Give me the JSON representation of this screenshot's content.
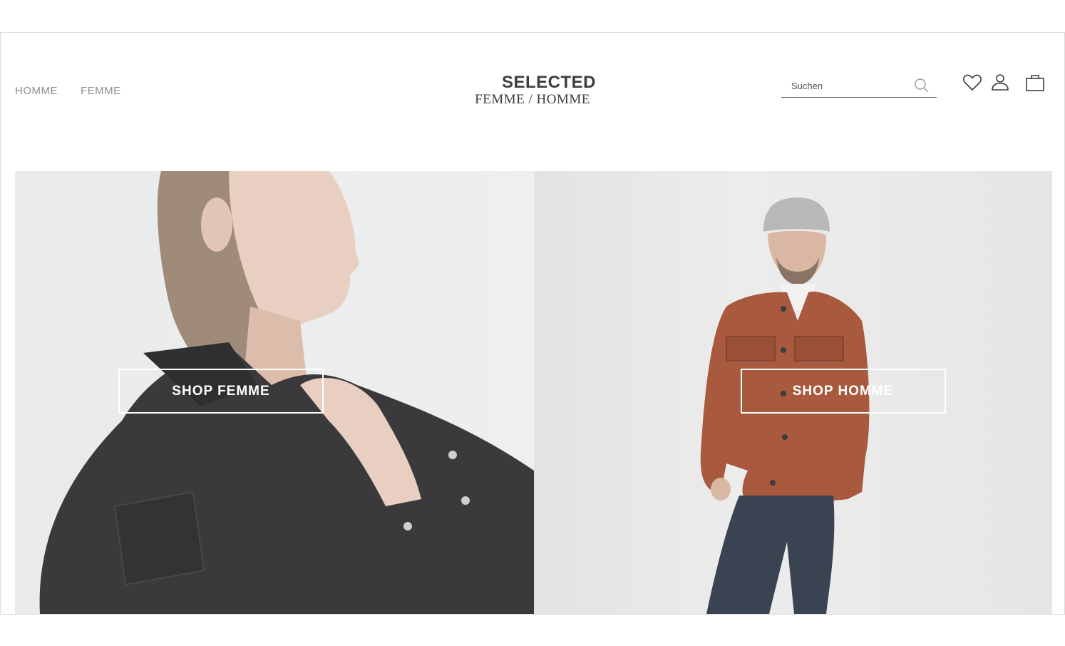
{
  "header": {
    "nav": [
      {
        "label": "HOMME"
      },
      {
        "label": "FEMME"
      }
    ],
    "logo": {
      "top": "SELECTED",
      "bottom": "FEMME / HOMME"
    },
    "search": {
      "placeholder": "Suchen",
      "icon": "search-icon"
    },
    "icons": [
      "heart-icon",
      "user-icon",
      "bag-icon"
    ]
  },
  "hero": {
    "left": {
      "cta_label": "SHOP FEMME"
    },
    "right": {
      "cta_label": "SHOP HOMME"
    }
  },
  "colors": {
    "text_gray": "#8c8c8c",
    "logo": "#3d3d3d",
    "cta": "#ffffff"
  }
}
